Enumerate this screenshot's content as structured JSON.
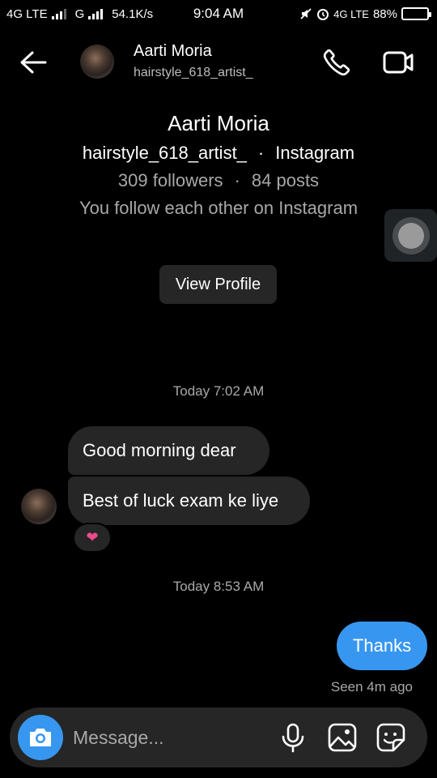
{
  "status_bar": {
    "network1": "4G LTE",
    "network2": "G",
    "speed": "54.1K/s",
    "time": "9:04 AM",
    "network3": "4G LTE",
    "battery": "88%",
    "battery_level": 0.88
  },
  "header": {
    "name": "Aarti Moria",
    "username": "hairstyle_618_artist_"
  },
  "profile": {
    "name": "Aarti Moria",
    "username": "hairstyle_618_artist_",
    "separator": "·",
    "platform": "Instagram",
    "followers": "309 followers",
    "posts": "84 posts",
    "mutual": "You follow each other on Instagram",
    "view_profile_label": "View Profile"
  },
  "messages": {
    "timestamp1": "Today 7:02 AM",
    "incoming1": "Good morning dear",
    "incoming2": "Best of luck exam ke liye",
    "reaction": "❤",
    "timestamp2": "Today 8:53 AM",
    "outgoing1": "Thanks",
    "seen": "Seen 4m ago"
  },
  "composer": {
    "placeholder": "Message..."
  },
  "colors": {
    "background": "#000000",
    "bubble_incoming": "#262626",
    "bubble_outgoing": "#3797f0",
    "reaction_heart": "#ed4b8c",
    "secondary_text": "#a8a8a8"
  },
  "icons": [
    "back-arrow-icon",
    "phone-icon",
    "video-camera-icon",
    "camera-icon",
    "microphone-icon",
    "gallery-icon",
    "sticker-icon",
    "heart-icon"
  ]
}
